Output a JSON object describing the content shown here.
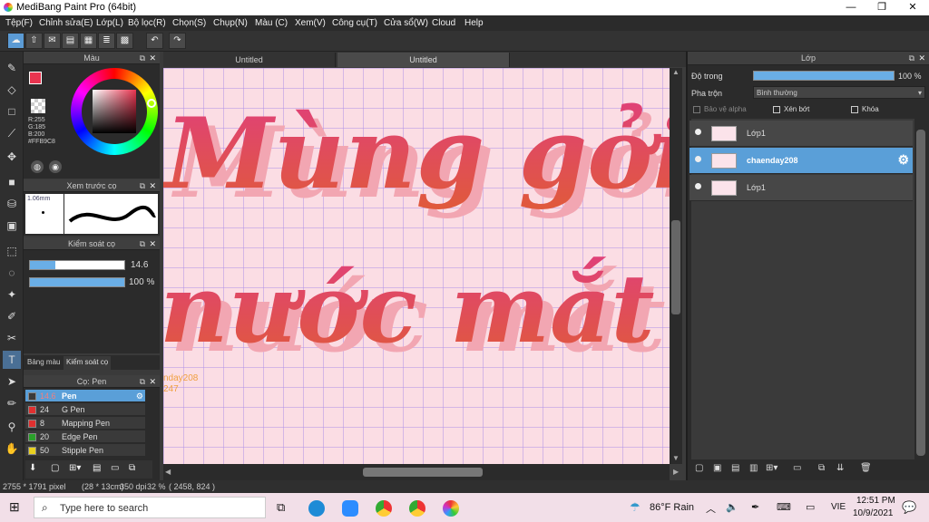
{
  "window": {
    "title": "MediBang Paint Pro (64bit)",
    "minimize": "—",
    "maximize": "❐",
    "close": "✕"
  },
  "menu": [
    "Tệp(F)",
    "Chỉnh sửa(E)",
    "Lớp(L)",
    "Bộ lọc(R)",
    "Chọn(S)",
    "Chụp(N)",
    "Màu (C)",
    "Xem(V)",
    "Công cụ(T)",
    "Cửa sổ(W)",
    "Cloud",
    "Help"
  ],
  "color_panel": {
    "title": "Màu",
    "r": "R:255",
    "g": "G:185",
    "b": "B:200",
    "hex": "#FFB9C8",
    "primary_color": "#e8344f",
    "secondary_color": "#ffffff"
  },
  "brush_preview": {
    "title": "Xem trước cọ",
    "size": "1.06mm"
  },
  "brush_control": {
    "title": "Kiểm soát cọ",
    "size_value": "14.6",
    "size_fill": 0.27,
    "opacity_value": "100 %",
    "opacity_fill": 1.0
  },
  "panel_tabs": {
    "palette": "Bảng màu",
    "control": "Kiểm soát cọ"
  },
  "brush_list": {
    "title": "Cọ: Pen",
    "items": [
      {
        "size": "14.6",
        "name": "Pen",
        "color": "#3a3a3a",
        "selected": true
      },
      {
        "size": "24",
        "name": "G Pen",
        "color": "#e03030",
        "selected": false
      },
      {
        "size": "8",
        "name": "Mapping Pen",
        "color": "#e03030",
        "selected": false
      },
      {
        "size": "20",
        "name": "Edge Pen",
        "color": "#2aa02a",
        "selected": false
      },
      {
        "size": "50",
        "name": "Stipple Pen",
        "color": "#e8d020",
        "selected": false
      }
    ]
  },
  "tabs": [
    "Untitled",
    "Untitled"
  ],
  "canvas": {
    "line1": "Mùng gởi",
    "line2": "nước mắt",
    "side_text_1": "nday208",
    "side_text_2": "247"
  },
  "layers_panel": {
    "title": "Lớp",
    "opacity_label": "Độ trong",
    "opacity_value": "100 %",
    "opacity_fill": 1.0,
    "blend_label": "Pha trộn",
    "blend_value": "Bình thường",
    "protect_alpha": "Bảo vệ alpha",
    "clipping": "Xén bớt",
    "lock": "Khóa",
    "layers": [
      {
        "name": "Lớp1",
        "selected": false
      },
      {
        "name": "chaenday208",
        "selected": true
      },
      {
        "name": "Lớp1",
        "selected": false
      }
    ]
  },
  "status": {
    "size": "2755 * 1791 pixel",
    "cm": "(28 * 13cm)",
    "dpi": "350 dpi",
    "zoom": "32 %",
    "coords": "( 2458, 824 )"
  },
  "taskbar": {
    "search": "Type here to search",
    "weather": "86°F Rain",
    "lang": "VIE",
    "time": "12:51 PM",
    "date": "10/9/2021"
  }
}
